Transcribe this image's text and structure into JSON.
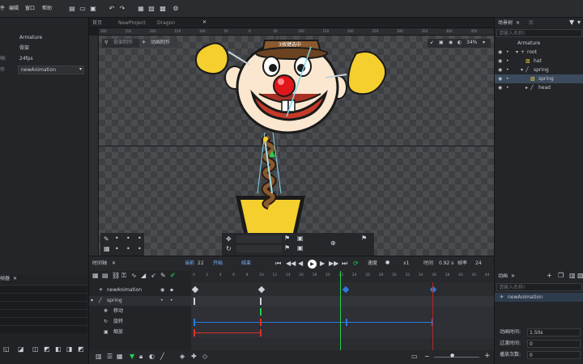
{
  "menu": [
    "件",
    "编辑",
    "窗口",
    "帮助"
  ],
  "colors": {
    "accent_blue": "#4aa3ff",
    "playhead_green": "#23d14a",
    "key_red": "#e0302a",
    "key_blue": "#2b7be0",
    "clown_yellow": "#f4cf2e"
  },
  "left_panel": {
    "items": [
      "Armature",
      "骨架",
      "24fps",
      "newAnimation"
    ],
    "frame_label": "帧:",
    "anim_label": "作",
    "bottom_title": "帧器",
    "close": "✕"
  },
  "tabs": {
    "doc1": "首页",
    "doc2": "NewProject",
    "doc3": "Dragon"
  },
  "viewport": {
    "mode_armature": "骨架制作",
    "mode_animation": "动画制作",
    "zoom": "34%",
    "bone_tooltip": "3按键选中",
    "ruler_ticks": [
      "300",
      "250",
      "200",
      "150",
      "100",
      "50",
      "0",
      "50",
      "100",
      "150",
      "200",
      "250",
      "300",
      "350",
      "400",
      "450"
    ]
  },
  "timeline": {
    "title": "时间轴",
    "close": "✕",
    "current_label": "当前",
    "current_value": "22",
    "start_label": "开始",
    "end_label": "结束",
    "speed_label": "速度",
    "speed_value": "x1",
    "time_label": "时间",
    "time_value": "0.92 s",
    "fps_label": "帧率",
    "fps_value": "24",
    "frame_numbers": [
      "0",
      "2",
      "4",
      "6",
      "8",
      "10",
      "12",
      "14",
      "16",
      "18",
      "20",
      "22",
      "24",
      "26",
      "28",
      "30",
      "32",
      "34",
      "36",
      "38",
      "40",
      "42",
      "44"
    ],
    "layers": [
      {
        "name": "newAnimation"
      },
      {
        "name": "spring"
      },
      {
        "name": "移动"
      },
      {
        "name": "旋转"
      },
      {
        "name": "缩放"
      }
    ],
    "playhead_frame": 22
  },
  "right_panel": {
    "scene_title": "场景树",
    "scene_close": "✕",
    "library_tab": "库",
    "search_placeholder": "请输入名称!",
    "tree": [
      "Armature",
      "root",
      "hat",
      "spring",
      "spring",
      "head"
    ],
    "anim_title": "动画",
    "anim_close": "✕",
    "anim_search": "请输入名称!",
    "anim_items": [
      "newAnimation"
    ],
    "anim_time_label": "动画时间:",
    "anim_time_value": "1.50s",
    "blend_label": "过渡时间:",
    "blend_value": "0",
    "play_times_label": "播放次数:",
    "play_times_value": "0"
  }
}
